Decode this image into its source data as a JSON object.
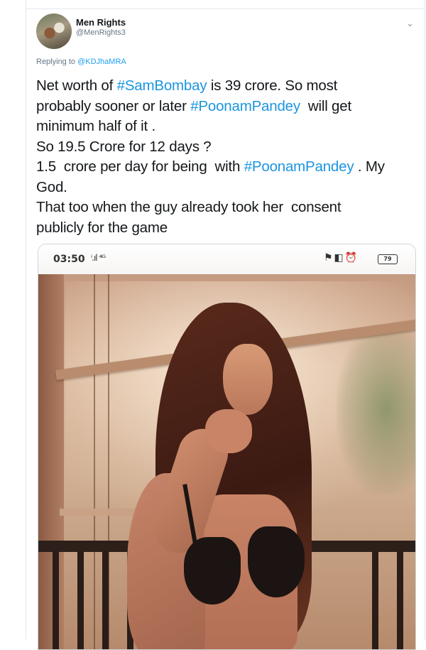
{
  "tweet": {
    "author_name": "Men Rights",
    "author_handle": "@MenRights3",
    "replying_label": "Replying to ",
    "replying_to": "@KDJhaMRA",
    "text_lines": [
      {
        "pre": "Net worth of ",
        "tag": "#SamBombay",
        "post": " is 39 crore. So most"
      },
      {
        "pre": "probably sooner or later ",
        "tag": "#PoonamPandey",
        "post": "  will get"
      },
      {
        "pre": "minimum half of it .",
        "tag": "",
        "post": ""
      },
      {
        "pre": "So 19.5 Crore for 12 days ?",
        "tag": "",
        "post": ""
      },
      {
        "pre": "1.5  crore per day for being  with ",
        "tag": "#PoonamPandey",
        "post": " . My"
      },
      {
        "pre": "God.",
        "tag": "",
        "post": ""
      },
      {
        "pre": "That too when the guy already took her  consent",
        "tag": "",
        "post": ""
      },
      {
        "pre": "publicly for the game",
        "tag": "",
        "post": ""
      }
    ]
  },
  "media": {
    "status_time": "03:50",
    "status_signal": "ⁱ.ıl ⁴ᴳ",
    "status_icons": "⚑◧⏰",
    "battery": "79"
  },
  "icons": {
    "caret": "chevron-down-icon"
  }
}
